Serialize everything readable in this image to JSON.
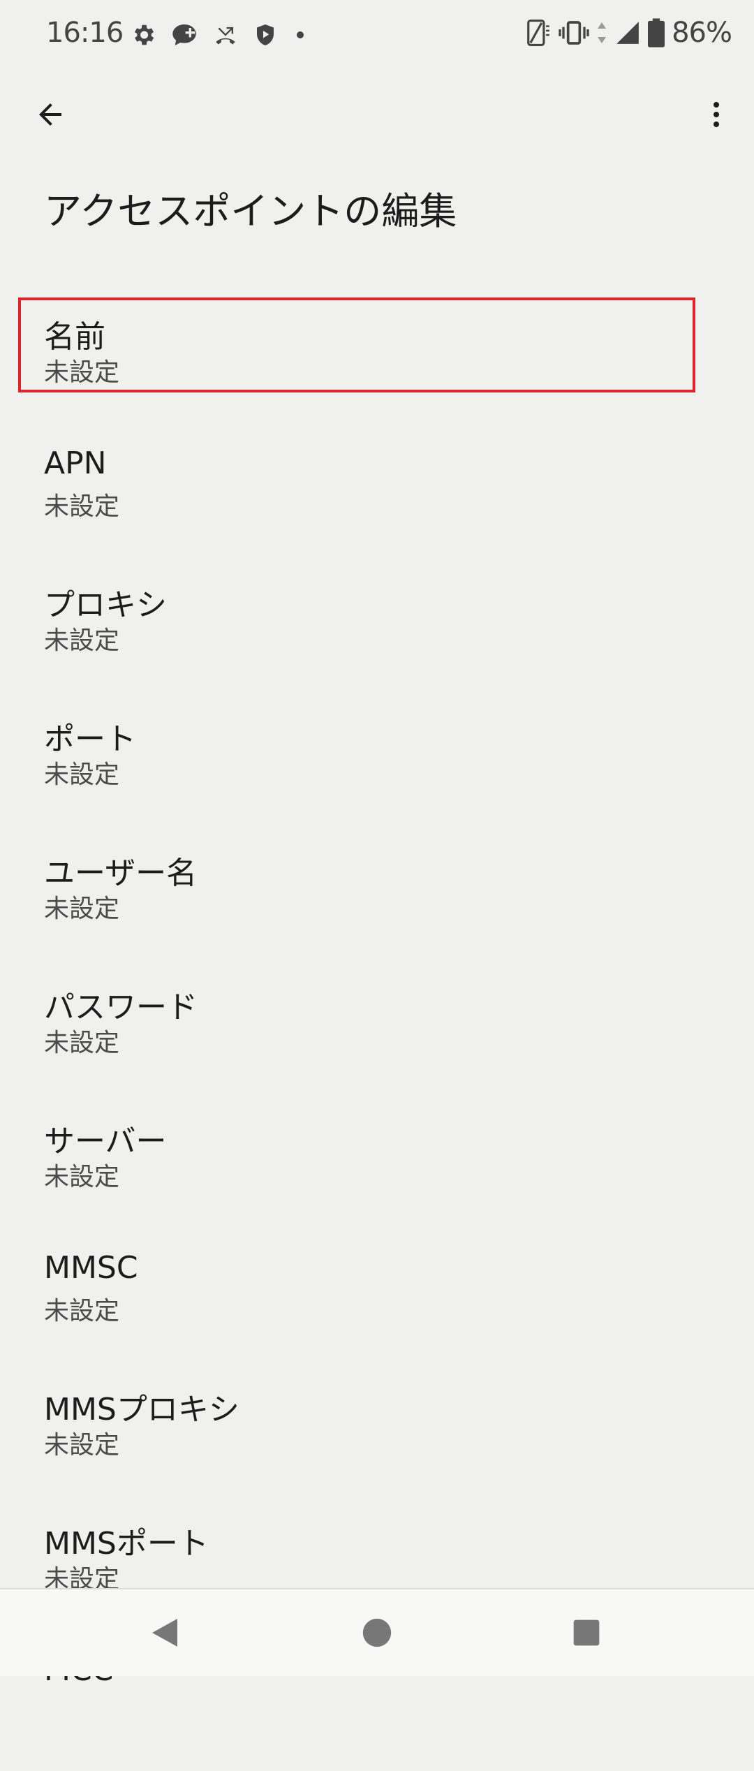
{
  "status_bar": {
    "time": "16:16",
    "battery_percent": "86%",
    "left_icons": [
      "settings-icon",
      "chat-add-icon",
      "missed-call-icon",
      "shield-play-icon",
      "dot-icon"
    ],
    "right_icons": [
      "no-sim-icon",
      "vibrate-icon",
      "data-arrows-icon",
      "signal-icon",
      "battery-icon"
    ]
  },
  "app_bar": {
    "title": "アクセスポイントの編集",
    "back_icon": "arrow-back-icon",
    "more_icon": "more-vert-icon"
  },
  "settings": {
    "items": [
      {
        "title": "名前",
        "summary": "未設定"
      },
      {
        "title": "APN",
        "summary": "未設定"
      },
      {
        "title": "プロキシ",
        "summary": "未設定"
      },
      {
        "title": "ポート",
        "summary": "未設定"
      },
      {
        "title": "ユーザー名",
        "summary": "未設定"
      },
      {
        "title": "パスワード",
        "summary": "未設定"
      },
      {
        "title": "サーバー",
        "summary": "未設定"
      },
      {
        "title": "MMSC",
        "summary": "未設定"
      },
      {
        "title": "MMSプロキシ",
        "summary": "未設定"
      },
      {
        "title": "MMSポート",
        "summary": "未設定"
      },
      {
        "title": "MCC",
        "summary": ""
      }
    ],
    "highlight_color": "#e0242f"
  },
  "nav_bar": {
    "back_icon": "nav-back-triangle-icon",
    "home_icon": "nav-home-circle-icon",
    "recents_icon": "nav-recents-square-icon"
  }
}
